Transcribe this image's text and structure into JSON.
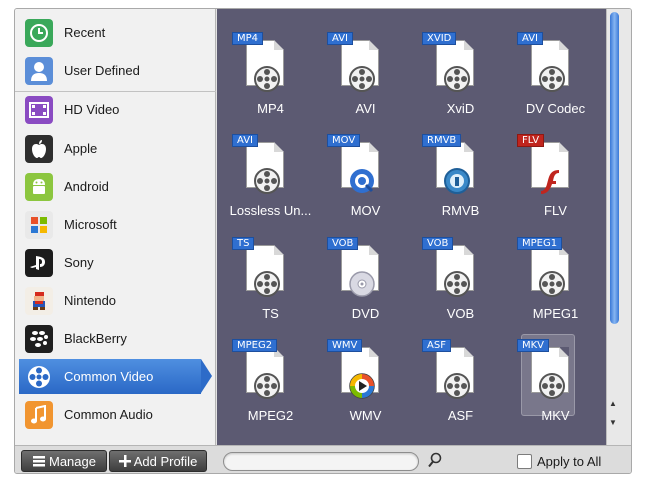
{
  "sidebar": {
    "items": [
      {
        "label": "Recent",
        "icon": "clock-icon"
      },
      {
        "label": "User Defined",
        "icon": "user-icon"
      },
      {
        "label": "HD Video",
        "icon": "film-icon"
      },
      {
        "label": "Apple",
        "icon": "apple-icon"
      },
      {
        "label": "Android",
        "icon": "android-icon"
      },
      {
        "label": "Microsoft",
        "icon": "windows-icon"
      },
      {
        "label": "Sony",
        "icon": "playstation-icon"
      },
      {
        "label": "Nintendo",
        "icon": "mario-icon"
      },
      {
        "label": "BlackBerry",
        "icon": "blackberry-icon"
      },
      {
        "label": "Common Video",
        "icon": "film-reel-icon",
        "selected": true
      },
      {
        "label": "Common Audio",
        "icon": "music-note-icon"
      }
    ]
  },
  "formats": [
    {
      "label": "MP4",
      "tag": "MP4",
      "icon": "film-reel-icon"
    },
    {
      "label": "AVI",
      "tag": "AVI",
      "icon": "film-reel-icon"
    },
    {
      "label": "XviD",
      "tag": "XVID",
      "icon": "film-reel-icon"
    },
    {
      "label": "DV Codec",
      "tag": "AVI",
      "icon": "film-reel-icon"
    },
    {
      "label": "Lossless Un...",
      "tag": "AVI",
      "icon": "film-reel-icon"
    },
    {
      "label": "MOV",
      "tag": "MOV",
      "icon": "quicktime-icon"
    },
    {
      "label": "RMVB",
      "tag": "RMVB",
      "icon": "realplayer-icon"
    },
    {
      "label": "FLV",
      "tag": "FLV",
      "icon": "flash-icon"
    },
    {
      "label": "TS",
      "tag": "TS",
      "icon": "film-reel-icon"
    },
    {
      "label": "DVD",
      "tag": "VOB",
      "icon": "disc-icon"
    },
    {
      "label": "VOB",
      "tag": "VOB",
      "icon": "film-reel-icon"
    },
    {
      "label": "MPEG1",
      "tag": "MPEG1",
      "icon": "film-reel-icon"
    },
    {
      "label": "MPEG2",
      "tag": "MPEG2",
      "icon": "film-reel-icon"
    },
    {
      "label": "WMV",
      "tag": "WMV",
      "icon": "windows-media-icon"
    },
    {
      "label": "ASF",
      "tag": "ASF",
      "icon": "film-reel-icon"
    },
    {
      "label": "MKV",
      "tag": "MKV",
      "icon": "film-reel-icon",
      "selected": true
    }
  ],
  "bottom": {
    "manage_label": "Manage",
    "add_profile_label": "Add Profile",
    "search_placeholder": "",
    "apply_to_all_label": "Apply to All",
    "apply_to_all_checked": false
  },
  "colors": {
    "panel_bg": "#5c5a72",
    "selection": "#2d6bc8",
    "tag_blue": "#2f6fd0",
    "flv_tag_red": "#c0251e"
  }
}
